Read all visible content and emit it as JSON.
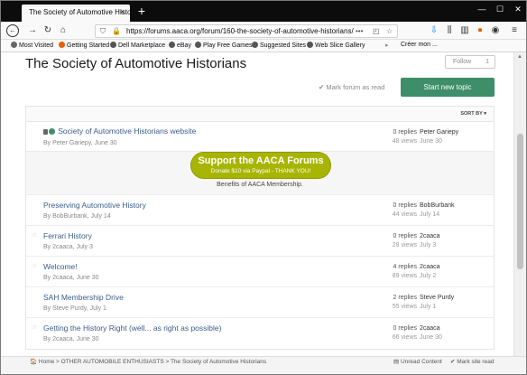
{
  "browser": {
    "tab_title": "The Society of Automotive Historians",
    "tab_close": "×",
    "new_tab": "+",
    "url": "https://forums.aaca.org/forum/160-the-society-of-automotive-historians/",
    "url_more": "•••",
    "window_controls": [
      "—",
      "☐",
      "✕"
    ],
    "bookmarks": [
      {
        "label": "Most Visited",
        "icon": "gear-icon",
        "color": "#666666"
      },
      {
        "label": "Getting Started",
        "icon": "firefox-icon",
        "color": "#e66000"
      },
      {
        "label": "Dell Marketplace",
        "icon": "globe-icon",
        "color": "#555555"
      },
      {
        "label": "eBay",
        "icon": "globe-icon",
        "color": "#555555"
      },
      {
        "label": "Play Free Games",
        "icon": "globe-icon",
        "color": "#555555"
      },
      {
        "label": "Suggested Sites",
        "icon": "globe-icon",
        "color": "#555555"
      },
      {
        "label": "Web Slice Gallery",
        "icon": "globe-icon",
        "color": "#555555"
      },
      {
        "label": "Créer mon ...",
        "icon": "folder-icon",
        "color": "#555555"
      }
    ]
  },
  "forum": {
    "title": "The Society of Automotive Historians",
    "follow_label": "Follow",
    "follow_count": "1",
    "mark_read": "✔ Mark forum as read",
    "start_topic": "Start new topic",
    "sort_by": "SORT BY ▾",
    "accent_color": "#3e8e6a",
    "pinned_topic": {
      "title": "Society of Automotive Historians website",
      "meta": "By Peter Gariepy, June 30",
      "replies": "0 replies",
      "views": "48 views",
      "last_author": "Peter Gariepy",
      "last_date": "June 30"
    },
    "ad": {
      "title": "Support the AACA Forums",
      "subtitle": "Donate $10 via Paypal - THANK YOU!",
      "benefits": "Benefits of AACA Membership."
    },
    "topics": [
      {
        "title": "Preserving Automotive History",
        "meta": "By BobBurbank, July 14",
        "replies": "0 replies",
        "views": "44 views",
        "last_author": "BobBurbank",
        "last_date": "July 14"
      },
      {
        "title": "Ferrari History",
        "meta": "By 2caaca, July 3",
        "replies": "0 replies",
        "views": "28 views",
        "last_author": "2caaca",
        "last_date": "July 3"
      },
      {
        "title": "Welcome!",
        "meta": "By 2caaca, June 30",
        "replies": "4 replies",
        "views": "89 views",
        "last_author": "2caaca",
        "last_date": "July 2"
      },
      {
        "title": "SAH Membership Drive",
        "meta": "By Steve Purdy, July 1",
        "replies": "2 replies",
        "views": "55 views",
        "last_author": "Steve Purdy",
        "last_date": "July 1"
      },
      {
        "title": "Getting the History Right (well... as right as possible)",
        "meta": "By 2caaca, June 30",
        "replies": "0 replies",
        "views": "66 views",
        "last_author": "2caaca",
        "last_date": "June 30"
      }
    ]
  },
  "footer": {
    "breadcrumb": "🏠 Home > OTHER AUTOMOBILE ENTHUSIASTS > The Society of Automotive Historians",
    "unread": "▤ Unread Content",
    "mark_site_read": "✔ Mark site read"
  }
}
